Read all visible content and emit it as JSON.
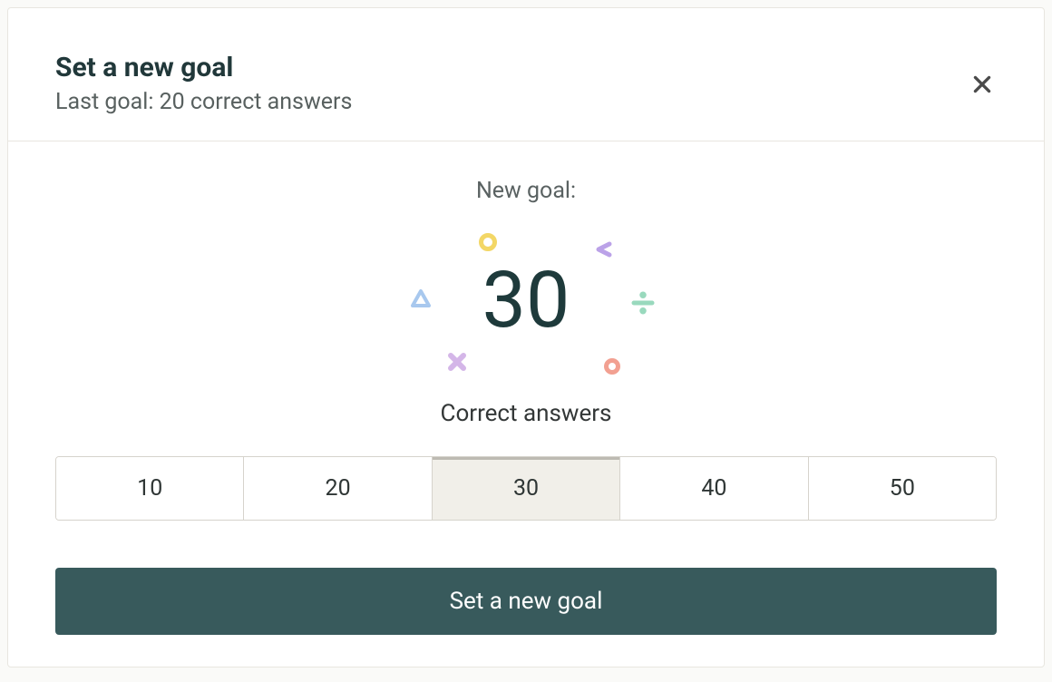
{
  "header": {
    "title": "Set a new goal",
    "subtitle": "Last goal: 20 correct answers"
  },
  "body": {
    "new_goal_label": "New goal:",
    "goal_value": "30",
    "correct_answers_label": "Correct answers",
    "options": [
      {
        "label": "10",
        "selected": false
      },
      {
        "label": "20",
        "selected": false
      },
      {
        "label": "30",
        "selected": true
      },
      {
        "label": "40",
        "selected": false
      },
      {
        "label": "50",
        "selected": false
      }
    ]
  },
  "footer": {
    "submit_label": "Set a new goal"
  }
}
